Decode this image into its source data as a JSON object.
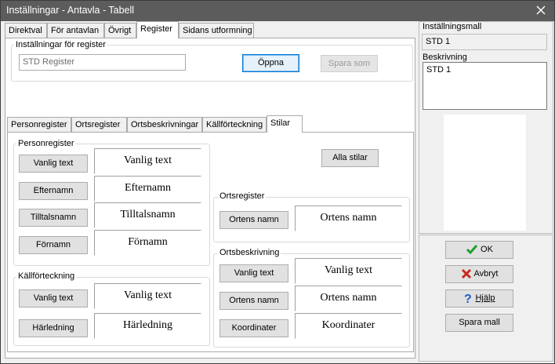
{
  "window": {
    "title": "Inställningar - Antavla - Tabell"
  },
  "main_tabs": [
    {
      "label": "Direktval"
    },
    {
      "label": "För antavlan"
    },
    {
      "label": "Övrigt"
    },
    {
      "label": "Register"
    },
    {
      "label": "Sidans utformning"
    }
  ],
  "register_settings": {
    "group_label": "Inställningar för register",
    "name_value": "STD Register",
    "open_label": "Öppna",
    "save_as_label": "Spara som"
  },
  "sub_tabs": [
    {
      "label": "Personregister"
    },
    {
      "label": "Ortsregister"
    },
    {
      "label": "Ortsbeskrivningar"
    },
    {
      "label": "Källförteckning"
    },
    {
      "label": "Stilar"
    }
  ],
  "styles": {
    "all_styles_label": "Alla stilar",
    "personregister": {
      "label": "Personregister",
      "rows": [
        {
          "button": "Vanlig text",
          "preview": "Vanlig text"
        },
        {
          "button": "Efternamn",
          "preview": "Efternamn"
        },
        {
          "button": "Tilltalsnamn",
          "preview": "Tilltalsnamn"
        },
        {
          "button": "Förnamn",
          "preview": "Förnamn"
        }
      ]
    },
    "kallforteckning": {
      "label": "Källförteckning",
      "rows": [
        {
          "button": "Vanlig text",
          "preview": "Vanlig text"
        },
        {
          "button": "Härledning",
          "preview": "Härledning"
        }
      ]
    },
    "ortsregister": {
      "label": "Ortsregister",
      "rows": [
        {
          "button": "Ortens namn",
          "preview": "Ortens namn"
        }
      ]
    },
    "ortsbeskrivning": {
      "label": "Ortsbeskrivning",
      "rows": [
        {
          "button": "Vanlig text",
          "preview": "Vanlig text"
        },
        {
          "button": "Ortens namn",
          "preview": "Ortens namn"
        },
        {
          "button": "Koordinater",
          "preview": "Koordinater"
        }
      ]
    }
  },
  "side": {
    "template_label": "Inställningsmall",
    "template_value": "STD 1",
    "description_label": "Beskrivning",
    "description_value": "STD 1",
    "ok_label": "OK",
    "cancel_label": "Avbryt",
    "help_label": "Hjälp",
    "save_template_label": "Spara mall"
  },
  "colors": {
    "titlebar": "#5c5c5c",
    "ok_check": "#1e9e2e",
    "cancel_x": "#c8281e",
    "help_q": "#1f5fbf",
    "focus_border": "#0078d7"
  }
}
